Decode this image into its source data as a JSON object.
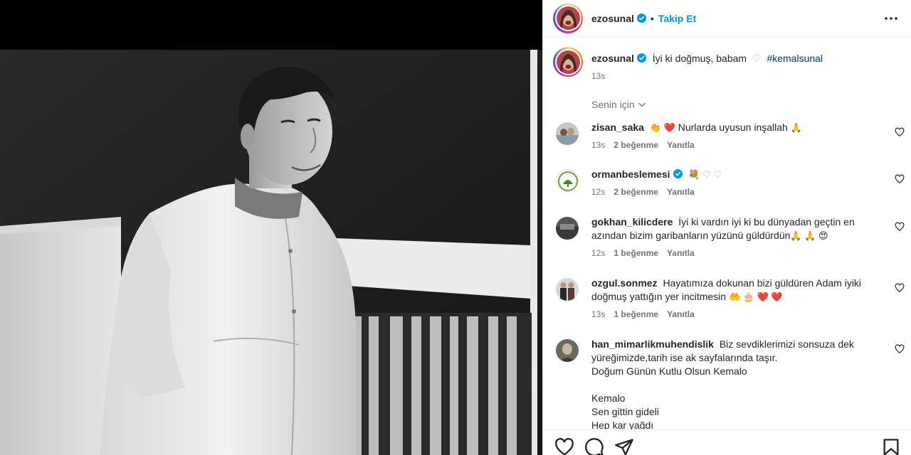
{
  "post": {
    "username": "ezosunal",
    "follow_label": "Takip Et",
    "separator": "•",
    "caption_text": "İyi ki doğmuş, babam",
    "caption_heart": "♡",
    "caption_hashtag": "#kemalsunal",
    "caption_time": "13s"
  },
  "comments_filter": {
    "label": "Senin için"
  },
  "comments": [
    {
      "user": "zisan_saka",
      "text": "Nurlarda uyusun inşallah",
      "emoji_before": "👏 ❤️",
      "emoji_after": "🙏",
      "time": "13s",
      "likes": "2 beğenme",
      "reply": "Yanıtla"
    },
    {
      "user": "ormanbeslemesi",
      "text": "",
      "emoji_before": "💐 ♡ ♡",
      "emoji_after": "",
      "time": "12s",
      "likes": "2 beğenme",
      "reply": "Yanıtla"
    },
    {
      "user": "gokhan_kilicdere",
      "text": "İyi ki vardın iyi ki bu dünyadan geçtin en azından bizim garibanların yüzünü güldürdün",
      "emoji_before": "",
      "emoji_after": "🙏 🙏 😍",
      "time": "12s",
      "likes": "1 beğenme",
      "reply": "Yanıtla"
    },
    {
      "user": "ozgul.sonmez",
      "text": "Hayatımıza dokunan bizi güldüren Adam iyiki doğmuş yattığın yer incitmesin",
      "emoji_before": "",
      "emoji_after": "🤲 🎂 ❤️ ❤️",
      "time": "13s",
      "likes": "1 beğenme",
      "reply": "Yanıtla"
    },
    {
      "user": "han_mimarlikmuhendislik",
      "text": "Biz sevdiklerimizi sonsuza dek yüreğimizde,tarih ise ak sayfalarında taşır.",
      "line2": "Doğum Günün Kutlu Olsun Kemalo",
      "line3": "Kemalo",
      "line4": "Sen gittin gideli",
      "line5": "Hep kar yağdı"
    }
  ],
  "icons": {
    "more": "more-horizontal-icon",
    "verified": "verified-badge-icon",
    "like": "heart-outline-icon",
    "comment": "comment-bubble-icon",
    "share": "paper-plane-icon",
    "save": "bookmark-icon"
  },
  "colors": {
    "link": "#0095f6",
    "verified": "#0095f6",
    "text": "#262626",
    "muted": "#737373",
    "hashtag": "#00376b"
  }
}
